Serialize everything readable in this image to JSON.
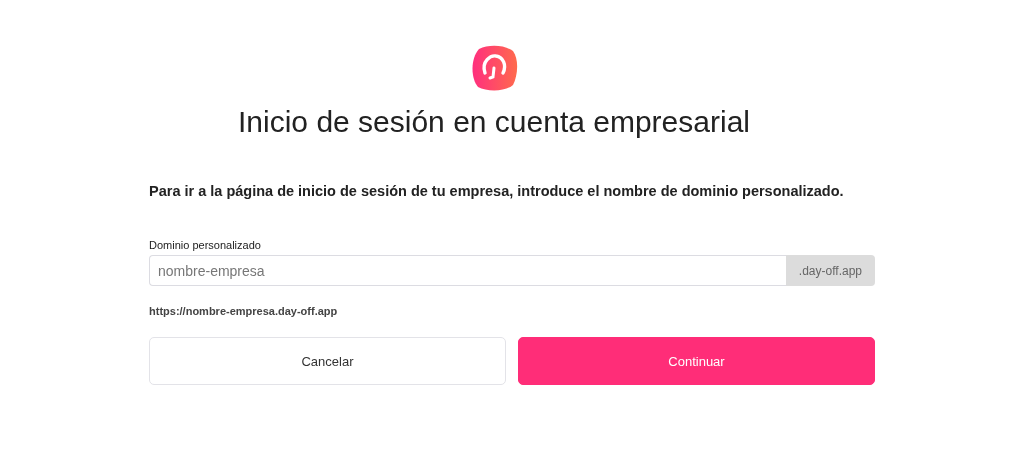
{
  "title": "Inicio de sesión en cuenta empresarial",
  "instruction": "Para ir a la página de inicio de sesión de tu empresa, introduce el nombre de dominio personalizado.",
  "domain_field": {
    "label": "Dominio personalizado",
    "placeholder": "nombre-empresa",
    "suffix": ".day-off.app"
  },
  "url_preview": "https://nombre-empresa.day-off.app",
  "buttons": [
    {
      "label": "Cancelar",
      "kind": "secondary"
    },
    {
      "label": "Continuar",
      "kind": "primary"
    }
  ]
}
